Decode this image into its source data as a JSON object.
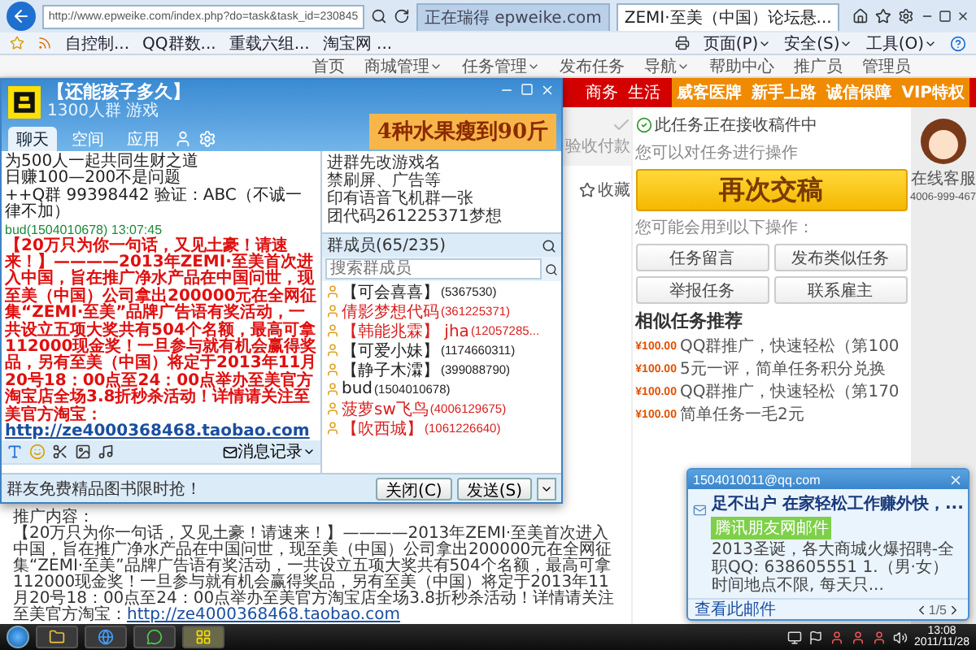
{
  "browser": {
    "address": "http://www.epweike.com/index.php?do=task&task_id=230845",
    "tabs": [
      {
        "label": "正在瑞得 epweike.com",
        "selected": false
      },
      {
        "label": "ZEMI·至美（中国）论坛悬...",
        "selected": true
      }
    ],
    "favorites": [
      "自控制...",
      "QQ群数...",
      "重载六组...",
      "淘宝网 ..."
    ],
    "commands": [
      "页面(P)",
      "安全(S)",
      "工具(O)"
    ]
  },
  "site": {
    "nav": [
      {
        "label": "首页",
        "dropdown": false
      },
      {
        "label": "商城管理",
        "dropdown": true
      },
      {
        "label": "任务管理",
        "dropdown": true
      },
      {
        "label": "发布任务",
        "dropdown": false
      },
      {
        "label": "导航",
        "dropdown": true
      },
      {
        "label": "帮助中心",
        "dropdown": false
      },
      {
        "label": "推广员",
        "dropdown": false
      },
      {
        "label": "管理员",
        "dropdown": false
      }
    ],
    "band_links": [
      "商务",
      "生活"
    ],
    "band_highlights": [
      "威客医牌",
      "新手上路",
      "诚信保障",
      "VIP特权"
    ],
    "progress_step": "验收付款",
    "favorite_link": "收藏",
    "promo": {
      "heading": "推广内容：",
      "text": "【20万只为你一句话，又见土豪！请速来！】————2013年ZEMI·至美首次进入中国，旨在推广净水产品在中国问世，现至美（中国）公司拿出200000元在全网征集“ZEMI·至美”品牌广告语有奖活动，一共设立五项大奖共有504个名额，最高可拿112000现金奖！一旦参与就有机会赢得奖品，另有至美（中国）将定于2013年11月20号18：00点至24：00点举办至美官方淘宝店全场3.8折秒杀活动！详情请关注至美官方淘宝：",
      "link": "http://ze4000368468.taobao.com"
    },
    "task_panel": {
      "status": "此任务正在接收稿件中",
      "hint": "您可以对任务进行操作",
      "primary_action": "再次交稿",
      "actions_hint": "您可能会用到以下操作：",
      "actions": [
        "任务留言",
        "发布类似任务",
        "举报任务",
        "联系雇主"
      ],
      "similar_title": "相似任务推荐",
      "similar": [
        {
          "price": "¥100.00",
          "title": "QQ群推广，快速轻松（第100"
        },
        {
          "price": "¥100.00",
          "title": "5元一评，简单任务积分兑换"
        },
        {
          "price": "¥100.00",
          "title": "QQ群推广，快速轻松（第170"
        },
        {
          "price": "¥100.00",
          "title": "简单任务一毛2元"
        }
      ]
    },
    "support": {
      "label": "在线客服",
      "phone": "4006-999-467"
    }
  },
  "qq_group": {
    "name": "【还能孩子多久】",
    "subtitle": "1300人群 游戏",
    "tabs": [
      {
        "label": "聊天",
        "selected": true
      },
      {
        "label": "空间",
        "selected": false
      },
      {
        "label": "应用",
        "selected": false
      }
    ],
    "ad": "4种水果瘦到90斤",
    "messages": [
      {
        "kind": "text",
        "text": "为500人一起共同生财之道"
      },
      {
        "kind": "text",
        "text": "日赚100—200不是问题"
      },
      {
        "kind": "text",
        "text": "++Q群 99398442 验证：ABC（不诚一律不加）"
      },
      {
        "kind": "sender",
        "text": "bud(1504010678)  13:07:45"
      },
      {
        "kind": "highlight",
        "text": "【20万只为你一句话，又见土豪！请速来！】————2013年ZEMI·至美首次进入中国，旨在推广净水产品在中国问世，现至美（中国）公司拿出200000元在全网征集“ZEMI·至美”品牌广告语有奖活动，一共设立五项大奖共有504个名额，最高可拿112000现金奖！一旦参与就有机会赢得奖品，另有至美（中国）将定于2013年11月20号18：00点至24：00点举办至美官方淘宝店全场3.8折秒杀活动！详情请关注至美官方淘宝：",
        "link": "http://ze4000368468.taobao.com"
      }
    ],
    "history_label": "消息记录",
    "notice": "群友免费精品图书限时抢！",
    "buttons": [
      "关闭(C)",
      "发送(S)"
    ],
    "announcement": [
      "进群先改游戏名",
      "禁刷屏、广告等",
      "印有语音飞机群一张",
      "团代码261225371梦想"
    ],
    "members_title": "群成员(65/235)",
    "member_search": {
      "placeholder": "搜索群成员"
    },
    "members": [
      {
        "name": "【可会喜喜】",
        "number": "(5367530)",
        "color": "#222222"
      },
      {
        "name": "倩影梦想代码",
        "number": "(361225371)",
        "color": "#d81e1e"
      },
      {
        "name": "【韩能兆霖】 jha",
        "number": "(12057285...",
        "color": "#d81e1e"
      },
      {
        "name": "【可爱小妹】",
        "number": "(1174660311)",
        "color": "#222222"
      },
      {
        "name": "【静子木瀮】",
        "number": "(399088790)",
        "color": "#222222"
      },
      {
        "name": "bud",
        "number": "(1504010678)",
        "color": "#222222"
      },
      {
        "name": "菠萝sw飞鸟",
        "number": "(4006129675)",
        "color": "#d81e1e"
      },
      {
        "name": "【吹西城】",
        "number": "(1061226640)",
        "color": "#d81e1e"
      }
    ]
  },
  "notification": {
    "account": "1504010011@qq.com",
    "subject": "足不出户 在家轻松工作赚外快，...",
    "source": "腾讯朋友网邮件",
    "preview": "2013圣诞，各大商城火爆招聘-全职QQ: 638605551 1.（男·女）时间地点不限, 每天只...",
    "action": "查看此邮件",
    "pager": "1/5"
  },
  "taskbar": {
    "time": "13:08",
    "date": "2011/11/28"
  }
}
